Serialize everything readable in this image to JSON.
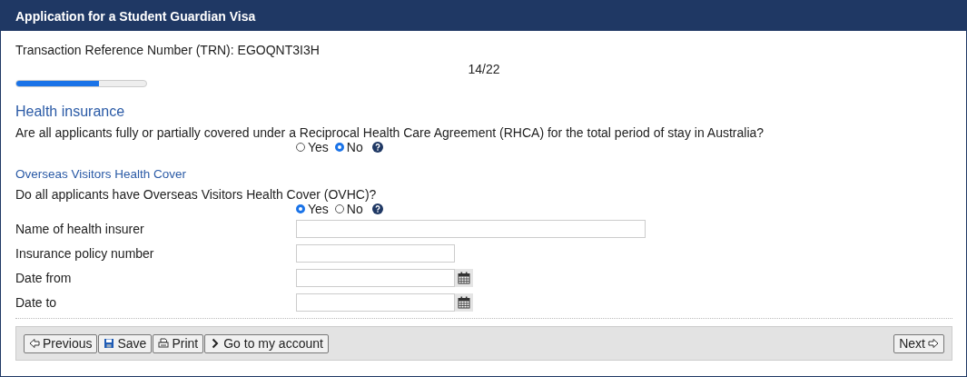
{
  "header": {
    "title": "Application for a Student Guardian Visa"
  },
  "trn": "Transaction Reference Number (TRN): EGOQNT3I3H",
  "progress": {
    "label": "14/22",
    "level": 0.636
  },
  "sections": [
    {
      "kind": "main",
      "heading": "Health insurance",
      "question": "Are all applicants fully or partially covered under a Reciprocal Health Care Agreement (RHCA) for the total period of stay in Australia?",
      "options": [
        {
          "label": "Yes",
          "selected": false
        },
        {
          "label": "No",
          "selected": true
        }
      ]
    },
    {
      "kind": "sub",
      "heading": "Overseas Visitors Health Cover",
      "question": "Do all applicants have Overseas Visitors Health Cover (OVHC)?",
      "options": [
        {
          "label": "Yes",
          "selected": true
        },
        {
          "label": "No",
          "selected": false
        }
      ]
    }
  ],
  "fields": [
    {
      "label": "Name of health insurer",
      "kind": "wide"
    },
    {
      "label": "Insurance policy number",
      "kind": "short"
    },
    {
      "label": "Date from",
      "kind": "date"
    },
    {
      "label": "Date to",
      "kind": "date"
    }
  ],
  "footer": {
    "left_buttons": [
      {
        "label": "Previous"
      },
      {
        "label": "Save"
      },
      {
        "label": "Print"
      },
      {
        "label": "Go to my account"
      }
    ],
    "right_buttons": [
      {
        "label": "Next"
      }
    ]
  }
}
